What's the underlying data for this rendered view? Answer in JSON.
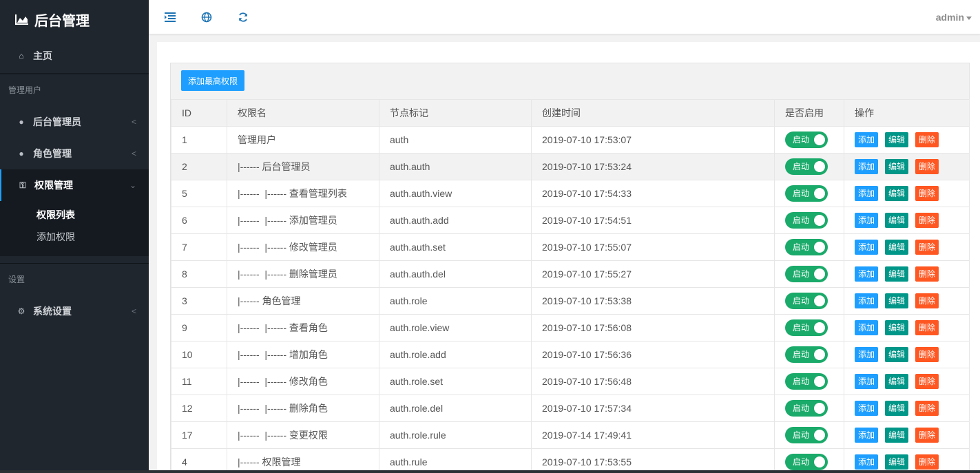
{
  "app": {
    "title": "后台管理"
  },
  "sidebar": {
    "home": "主页",
    "section_users": "管理用户",
    "items": [
      {
        "label": "后台管理员"
      },
      {
        "label": "角色管理"
      },
      {
        "label": "权限管理"
      }
    ],
    "sub_items": [
      {
        "label": "权限列表"
      },
      {
        "label": "添加权限"
      }
    ],
    "section_settings": "设置",
    "settings_item": "系统设置"
  },
  "header": {
    "user": "admin"
  },
  "toolbar": {
    "add_top": "添加最高权限"
  },
  "table": {
    "headers": [
      "ID",
      "权限名",
      "节点标记",
      "创建时间",
      "是否启用",
      "操作"
    ],
    "switch_label": "启动",
    "actions": {
      "add": "添加",
      "edit": "编辑",
      "delete": "删除"
    },
    "rows": [
      {
        "id": "1",
        "name": "管理用户",
        "node": "auth",
        "time": "2019-07-10 17:53:07"
      },
      {
        "id": "2",
        "name": "|------ 后台管理员",
        "node": "auth.auth",
        "time": "2019-07-10 17:53:24"
      },
      {
        "id": "5",
        "name": "|------  |------ 查看管理列表",
        "node": "auth.auth.view",
        "time": "2019-07-10 17:54:33"
      },
      {
        "id": "6",
        "name": "|------  |------ 添加管理员",
        "node": "auth.auth.add",
        "time": "2019-07-10 17:54:51"
      },
      {
        "id": "7",
        "name": "|------  |------ 修改管理员",
        "node": "auth.auth.set",
        "time": "2019-07-10 17:55:07"
      },
      {
        "id": "8",
        "name": "|------  |------ 删除管理员",
        "node": "auth.auth.del",
        "time": "2019-07-10 17:55:27"
      },
      {
        "id": "3",
        "name": "|------ 角色管理",
        "node": "auth.role",
        "time": "2019-07-10 17:53:38"
      },
      {
        "id": "9",
        "name": "|------  |------ 查看角色",
        "node": "auth.role.view",
        "time": "2019-07-10 17:56:08"
      },
      {
        "id": "10",
        "name": "|------  |------ 增加角色",
        "node": "auth.role.add",
        "time": "2019-07-10 17:56:36"
      },
      {
        "id": "11",
        "name": "|------  |------ 修改角色",
        "node": "auth.role.set",
        "time": "2019-07-10 17:56:48"
      },
      {
        "id": "12",
        "name": "|------  |------ 删除角色",
        "node": "auth.role.del",
        "time": "2019-07-10 17:57:34"
      },
      {
        "id": "17",
        "name": "|------  |------ 变更权限",
        "node": "auth.role.rule",
        "time": "2019-07-14 17:49:41"
      },
      {
        "id": "4",
        "name": "|------ 权限管理",
        "node": "auth.rule",
        "time": "2019-07-10 17:53:55"
      }
    ]
  },
  "colors": {
    "sidebar_bg": "#20262e",
    "accent": "#1e9fff",
    "switch_on": "#1aaa6a",
    "edit": "#009688",
    "delete": "#ff5722"
  }
}
